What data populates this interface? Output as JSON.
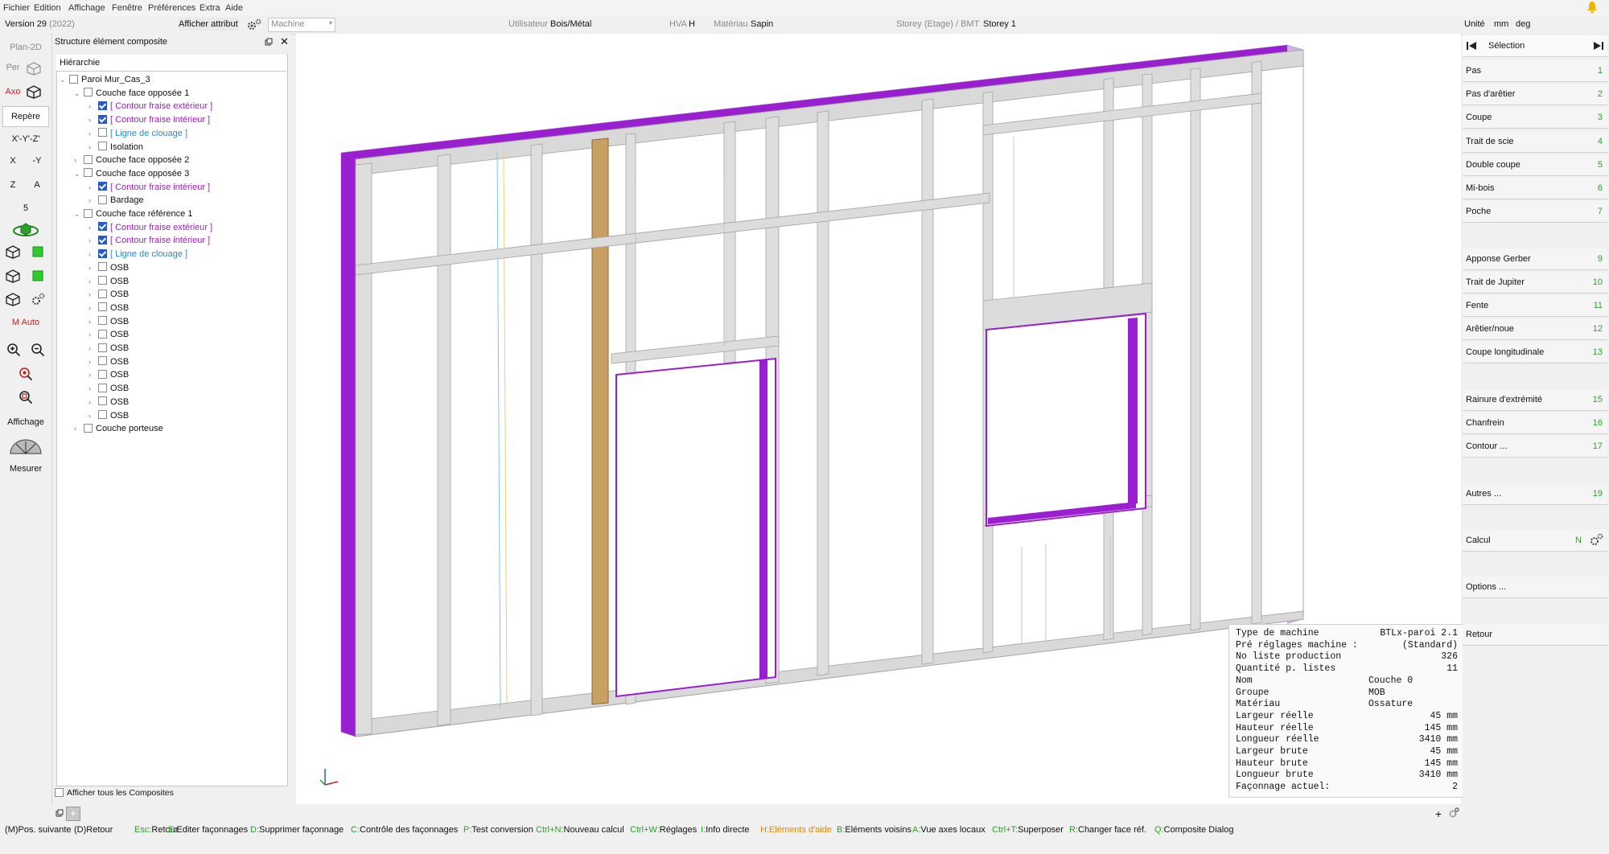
{
  "menu": [
    "Fichier",
    "Edition",
    "Affichage",
    "Fenêtre",
    "Préférences",
    "Extra",
    "Aide"
  ],
  "infobar": {
    "version": "Version 29",
    "year": "(2022)",
    "afficher_attribut": "Afficher attribut",
    "machine_placeholder": "Machine",
    "utilisateur_label": "Utilisateur",
    "utilisateur_value": "Bois/Métal",
    "hva_label": "HVA",
    "hva_value": "H",
    "materiau_label": "Matériau",
    "materiau_value": "Sapin",
    "storey_label": "Storey (Etage) / BMT",
    "storey_value": "Storey 1",
    "unite_label": "Unité",
    "unite_value": "mm",
    "angle_unit": "deg"
  },
  "lefttools": {
    "plan2d": "Plan-2D",
    "per": "Per",
    "axo": "Axo",
    "repere": "Repère",
    "xyz": "X'-Y'-Z'",
    "x": "X",
    "my": "-Y",
    "z": "Z",
    "a": "A",
    "five": "5",
    "mauto": "M Auto",
    "affichage": "Affichage",
    "mesurer": "Mesurer"
  },
  "tree": {
    "panel_title": "Structure élément composite",
    "header": "Hiérarchie",
    "show_all": "Afficher tous les Composites",
    "rows": [
      {
        "label": "Paroi Mur_Cas_3",
        "level": 0,
        "arrow": "v",
        "checked": false,
        "color": "normal"
      },
      {
        "label": "Couche face opposée 1",
        "level": 1,
        "arrow": "v",
        "checked": false,
        "color": "normal"
      },
      {
        "label": "[ Contour fraise extérieur ]",
        "level": 2,
        "arrow": ">",
        "checked": true,
        "color": "purple"
      },
      {
        "label": "[ Contour fraise intérieur ]",
        "level": 2,
        "arrow": ">",
        "checked": true,
        "color": "purple"
      },
      {
        "label": "[ Ligne de clouage ]",
        "level": 2,
        "arrow": ">",
        "checked": false,
        "color": "blue"
      },
      {
        "label": "Isolation",
        "level": 2,
        "arrow": ">",
        "checked": false,
        "color": "normal"
      },
      {
        "label": "Couche face opposée 2",
        "level": 1,
        "arrow": ">",
        "checked": false,
        "color": "normal"
      },
      {
        "label": "Couche face opposée 3",
        "level": 1,
        "arrow": "v",
        "checked": false,
        "color": "normal"
      },
      {
        "label": "[ Contour fraise intérieur ]",
        "level": 2,
        "arrow": ">",
        "checked": true,
        "color": "purple"
      },
      {
        "label": "Bardage",
        "level": 2,
        "arrow": ">",
        "checked": false,
        "color": "normal"
      },
      {
        "label": "Couche face référence 1",
        "level": 1,
        "arrow": "v",
        "checked": false,
        "color": "normal"
      },
      {
        "label": "[ Contour fraise extérieur ]",
        "level": 2,
        "arrow": ">",
        "checked": true,
        "color": "purple"
      },
      {
        "label": "[ Contour fraise intérieur ]",
        "level": 2,
        "arrow": ">",
        "checked": true,
        "color": "purple"
      },
      {
        "label": "[ Ligne de clouage ]",
        "level": 2,
        "arrow": ">",
        "checked": true,
        "color": "blue"
      },
      {
        "label": "OSB",
        "level": 2,
        "arrow": ">",
        "checked": false,
        "color": "normal"
      },
      {
        "label": "OSB",
        "level": 2,
        "arrow": ">",
        "checked": false,
        "color": "normal"
      },
      {
        "label": "OSB",
        "level": 2,
        "arrow": ">",
        "checked": false,
        "color": "normal"
      },
      {
        "label": "OSB",
        "level": 2,
        "arrow": ">",
        "checked": false,
        "color": "normal"
      },
      {
        "label": "OSB",
        "level": 2,
        "arrow": ">",
        "checked": false,
        "color": "normal"
      },
      {
        "label": "OSB",
        "level": 2,
        "arrow": ">",
        "checked": false,
        "color": "normal"
      },
      {
        "label": "OSB",
        "level": 2,
        "arrow": ">",
        "checked": false,
        "color": "normal"
      },
      {
        "label": "OSB",
        "level": 2,
        "arrow": ">",
        "checked": false,
        "color": "normal"
      },
      {
        "label": "OSB",
        "level": 2,
        "arrow": ">",
        "checked": false,
        "color": "normal"
      },
      {
        "label": "OSB",
        "level": 2,
        "arrow": ">",
        "checked": false,
        "color": "normal"
      },
      {
        "label": "OSB",
        "level": 2,
        "arrow": ">",
        "checked": false,
        "color": "normal"
      },
      {
        "label": "OSB",
        "level": 2,
        "arrow": ">",
        "checked": false,
        "color": "normal"
      },
      {
        "label": "Couche porteuse",
        "level": 1,
        "arrow": ">",
        "checked": false,
        "color": "normal"
      }
    ]
  },
  "rightpanel": {
    "selection": "Sélection",
    "calcul_letter": "N",
    "items": [
      {
        "label": "Pas",
        "num": "1",
        "slot": 0
      },
      {
        "label": "Pas d'arêtier",
        "num": "2",
        "slot": 1
      },
      {
        "label": "Coupe",
        "num": "3",
        "slot": 2
      },
      {
        "label": "Trait de scie",
        "num": "4",
        "slot": 3
      },
      {
        "label": "Double coupe",
        "num": "5",
        "slot": 4
      },
      {
        "label": "Mi-bois",
        "num": "6",
        "slot": 5
      },
      {
        "label": "Poche",
        "num": "7",
        "slot": 6
      },
      {
        "label": "Apponse Gerber",
        "num": "9",
        "slot": 8
      },
      {
        "label": "Trait de Jupiter",
        "num": "10",
        "slot": 9
      },
      {
        "label": "Fente",
        "num": "11",
        "slot": 10
      },
      {
        "label": "Arêtier/noue",
        "num": "12",
        "slot": 11
      },
      {
        "label": "Coupe longitudinale",
        "num": "13",
        "slot": 12
      },
      {
        "label": "Rainure d'extrémité",
        "num": "15",
        "slot": 14
      },
      {
        "label": "Chanfrein",
        "num": "16",
        "slot": 15
      },
      {
        "label": "Contour ...",
        "num": "17",
        "slot": 16
      },
      {
        "label": "Autres ...",
        "num": "19",
        "slot": 18
      },
      {
        "label": "Calcul",
        "num": "",
        "slot": 20
      },
      {
        "label": "Options ...",
        "num": "",
        "slot": 22
      },
      {
        "label": "Retour",
        "num": "",
        "slot": 24
      }
    ]
  },
  "info": {
    "rows": [
      {
        "k": "Type de machine",
        "v": "BTLx-paroi 2.1",
        "align": "right"
      },
      {
        "k": "Pré réglages machine :",
        "v": "(Standard)",
        "align": "right"
      },
      {
        "k": "No liste production",
        "v": "326",
        "align": "right"
      },
      {
        "k": "Quantité p. listes",
        "v": "11",
        "align": "right"
      },
      {
        "k": "Nom",
        "v": "Couche 0",
        "align": "left"
      },
      {
        "k": "Groupe",
        "v": "MOB",
        "align": "left"
      },
      {
        "k": "Matériau",
        "v": "Ossature",
        "align": "left"
      },
      {
        "k": "Largeur réelle",
        "v": "45 mm",
        "align": "right"
      },
      {
        "k": "Hauteur réelle",
        "v": "145 mm",
        "align": "right"
      },
      {
        "k": "Longueur réelle",
        "v": "3410 mm",
        "align": "right"
      },
      {
        "k": "Largeur brute",
        "v": "45 mm",
        "align": "right"
      },
      {
        "k": "Hauteur brute",
        "v": "145 mm",
        "align": "right"
      },
      {
        "k": "Longueur brute",
        "v": "3410 mm",
        "align": "right"
      },
      {
        "k": "Façonnage actuel:",
        "v": "2",
        "align": "right"
      }
    ]
  },
  "status": [
    {
      "key": "",
      "text": "(M)Pos. suivante",
      "kc": "normal"
    },
    {
      "key": "",
      "text": "(D)Retour",
      "kc": "normal"
    },
    {
      "key": "Esc:",
      "text": "Retour",
      "kc": "g"
    },
    {
      "key": "E:",
      "text": "Editer façonnages",
      "kc": "g"
    },
    {
      "key": "D:",
      "text": "Supprimer façonnage",
      "kc": "g"
    },
    {
      "key": "C:",
      "text": "Contrôle des façonnages",
      "kc": "g"
    },
    {
      "key": "P:",
      "text": "Test conversion",
      "kc": "g"
    },
    {
      "key": "Ctrl+N:",
      "text": "Nouveau calcul",
      "kc": "g"
    },
    {
      "key": "Ctrl+W:",
      "text": "Réglages",
      "kc": "g"
    },
    {
      "key": "I:",
      "text": "Info directe",
      "kc": "g"
    },
    {
      "key": "H:",
      "text": "Eléments d'aide",
      "kc": "o"
    },
    {
      "key": "B:",
      "text": "Eléments voisins",
      "kc": "g"
    },
    {
      "key": "A:",
      "text": "Vue axes locaux",
      "kc": "g"
    },
    {
      "key": "Ctrl+T:",
      "text": "Superposer",
      "kc": "g"
    },
    {
      "key": "R:",
      "text": "Changer face réf.",
      "kc": "g"
    },
    {
      "key": "Q:",
      "text": "Composite Dialog",
      "kc": "g"
    }
  ],
  "colors": {
    "accent_green": "#2ea02e",
    "purple": "#9a1fd0",
    "wood": "#c9a064",
    "checkbox_blue": "#2a5ac8"
  }
}
